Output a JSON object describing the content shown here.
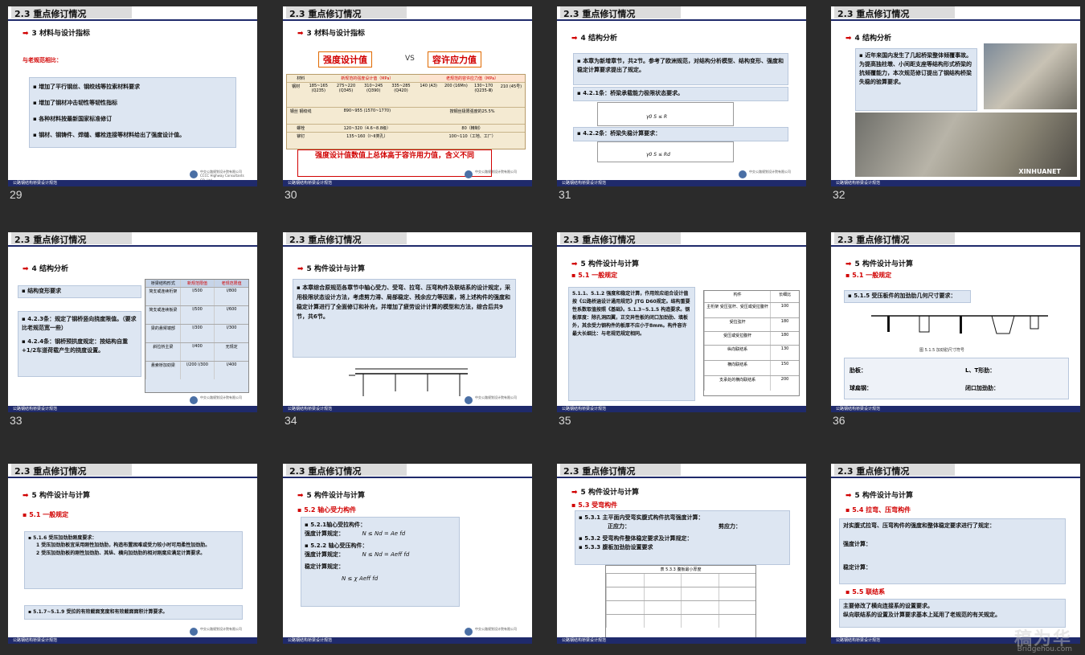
{
  "slides": [
    {
      "num": "29",
      "title": "2.3 重点修订情况",
      "heading": "3 材料与设计指标",
      "sub": "与老规范相比：",
      "bullets": [
        "增加了平行钢丝、钢绞线等拉索材料要求",
        "增加了钢材冲击韧性等韧性指标",
        "各种材料按最新国家标准修订",
        "钢材、钢铸件、焊缝、螺栓连接等材料给出了强度设计值。"
      ]
    },
    {
      "num": "30",
      "title": "2.3 重点修订情况",
      "heading": "3 材料与设计指标",
      "left_pill": "强度设计值",
      "vs": "VS",
      "right_pill": "容许应力值",
      "table_header": [
        "材料",
        "新规范的强度设计值（MPa）",
        "老规范的容许应力值（MPa）"
      ],
      "table_rows": [
        [
          "钢材",
          "185~165 (Q235)",
          "275~220 (Q345)",
          "310~245 (Q390)",
          "335~285 (Q420)",
          "140 (A3)",
          "200 (16Mn)",
          "130~170 (Q235-Ⅲ)",
          "210 (45号)"
        ],
        [
          "钢丝 钢绞线",
          "890~955 (1570~1770)",
          "880~1055 (1570~1960)",
          "",
          "",
          "按钢丝极限强度的25.5%"
        ],
        [
          "螺栓",
          "120~320（4.6~8.8级）",
          "",
          "",
          "",
          "80（精制）"
        ],
        [
          "铆钉",
          "135~160（Ⅰ~Ⅱ类孔）",
          "",
          "",
          "",
          "100~110（工地、工厂）"
        ]
      ],
      "red_note": "强度设计值数值上总体高于容许用力值，含义不同"
    },
    {
      "num": "31",
      "title": "2.3 重点修订情况",
      "heading": "4 结构分析",
      "box1": "本章为新增章节，共2节。参考了欧洲规范，对结构分析模型、结构变形、强度和稳定计算要求提出了规定。",
      "box2": "4.2.1条：桥梁承载能力极限状态要求。",
      "box3": "4.2.2条：桥梁失稳计算要求：",
      "formula1": "γ0 S ≤ R",
      "formula2": "γ0 S ≤ Rd"
    },
    {
      "num": "32",
      "title": "2.3 重点修订情况",
      "heading": "4 结构分析",
      "box1": "近年来国内发生了几起桥梁整体倾覆事故。为提高独柱墩、小间距支座等结构形式桥梁的抗倾覆能力，本次规范修订提出了钢结构桥梁失稳的验算要求。",
      "photo_caption": "XINHUANET"
    },
    {
      "num": "33",
      "title": "2.3 重点修订情况",
      "heading": "4 结构分析",
      "left1": "结构变形要求",
      "left2": "4.2.3条：规定了钢桥竖向挠度限值。（要求比老规范宽一些）",
      "left3": "4.2.4条：钢桥预拱度规定：按结构自重+1/2车道荷载产生的挠度设置。",
      "tbl_head": [
        "桥梁结构形式",
        "新规范限值",
        "老规范限值"
      ],
      "tbl_rows": [
        [
          "简支或连续桁架",
          "l/500",
          "l/800"
        ],
        [
          "简支或连续板梁",
          "l/500",
          "l/600"
        ],
        [
          "梁的悬臂端部",
          "l/300",
          "l/300"
        ],
        [
          "斜拉桥主梁",
          "l/400",
          "无规定"
        ],
        [
          "悬索桥加劲梁",
          "l/200 l/300",
          "l/400"
        ]
      ]
    },
    {
      "num": "34",
      "title": "2.3 重点修订情况",
      "heading": "5 构件设计与计算",
      "box": "本章综合原规范各章节中轴心受力、受弯、拉弯、压弯构件及联结系的设计规定，采用极限状态设计方法，考虑剪力滞、局部稳定、残余应力等因素，将上述构件的强度和稳定计算进行了全面修订和补充，并增加了疲劳设计计算的模型和方法，综合后共9节，共6节。"
    },
    {
      "num": "35",
      "title": "2.3 重点修订情况",
      "heading": "5 构件设计与计算",
      "sub": "5.1 一般规定",
      "box": "5.1.1、5.1.2 强度和稳定计算，作用效应组合设计值按《公路桥涵设计通用规范》JTG D60规定。结构重要性系数取值按照《基础》。5.1.3~5.1.5 构造要求。钢板厚度：除孔洞四翼，正交异性板的闭口加劲肋、填板外，其余受力钢构件的板厚不应小于8mm。构件容许最大长细比：与老规范规定相同。",
      "tbl_head": [
        "构件",
        "长细比"
      ],
      "tbl_rows": [
        [
          "主桁架 受压弦杆、受压或受拉腹杆",
          "100"
        ],
        [
          "受拉弦杆",
          "180"
        ],
        [
          "受压或受拉腹杆",
          "180"
        ],
        [
          "纵向联结系",
          "130"
        ],
        [
          "横向联结系",
          "150"
        ],
        [
          "支承处的横向联结系",
          "200"
        ]
      ]
    },
    {
      "num": "36",
      "title": "2.3 重点修订情况",
      "heading": "5 构件设计与计算",
      "sub": "5.1 一般规定",
      "box": "5.1.5 受压板件的加劲肋几何尺寸要求：",
      "caption": "图 5.1.5 加劲肋尺寸符号",
      "lbl1": "肋板：",
      "lbl2": "L、T形肋：",
      "lbl3": "球扁钢：",
      "lbl4": "闭口加劲肋："
    },
    {
      "num": "37",
      "title": "2.3 重点修订情况",
      "heading": "5 构件设计与计算",
      "sub": "5.1 一般规定",
      "box1_title": "5.1.6 受压加劲肋刚度要求：",
      "box1_l1": "1 受压加劲肋板宜采用刚性加劲肋，构造布置困难或受力较小时可用柔性加劲肋。",
      "box1_l2": "2 受压加劲肋板的刚性加劲肋、其纵、横向加劲肋的相对刚度应满足计算要求。",
      "box2": "5.1.7~5.1.9 受拉的有效截面宽度和有效截面面积计算要求。"
    },
    {
      "num": "38",
      "title": "2.3 重点修订情况",
      "heading": "5 构件设计与计算",
      "sub": "5.2 轴心受力构件",
      "l1": "5.2.1轴心受拉构件：",
      "l2": "强度计算规定：",
      "f2": "N ≤ Nd = Ae fd",
      "l3": "5.2.2 轴心受压构件：",
      "l4": "强度计算规定：",
      "f4": "N ≤ Nd = Aeff fd",
      "l5": "稳定计算规定：",
      "f5": "N ≤ χ Aeff fd"
    },
    {
      "num": "39",
      "title": "2.3 重点修订情况",
      "heading": "5 构件设计与计算",
      "sub": "5.3 受弯构件",
      "l1": "5.3.1 主平面内受弯实腹式构件抗弯强度计算：",
      "l2a": "正应力：",
      "l2b": "剪应力：",
      "l3": "5.3.2 受弯构件整体稳定要求及计算规定：",
      "l4": "5.3.3 腹板加劲肋设置要求",
      "tbl_title": "表 5.3.3  腹板最小厚度"
    },
    {
      "num": "40",
      "title": "2.3 重点修订情况",
      "heading": "5 构件设计与计算",
      "sub": "5.4 拉弯、压弯构件",
      "box1": "对实腹式拉弯、压弯构件的强度和整体稳定要求进行了规定：",
      "b1a": "强度计算：",
      "b1b": "稳定计算：",
      "sub2": "5.5 联结系",
      "box2a": "主要修改了横向连接系的设置要求。",
      "box2b": "纵向联结系的设置及计算要求基本上延用了老规范的有关规定。",
      "wm": "稿为华",
      "wm2": "Bridgehou.com"
    }
  ],
  "footer_text": "公路钢结构桥梁设计规范",
  "logo_cn": "中交公路规划设计院有限公司",
  "logo_en": "CCCC Highway Consultants CO.,Ltd.",
  "colors": {
    "navy": "#1f2a6b",
    "red": "#d10000",
    "box": "#dde6f2"
  }
}
